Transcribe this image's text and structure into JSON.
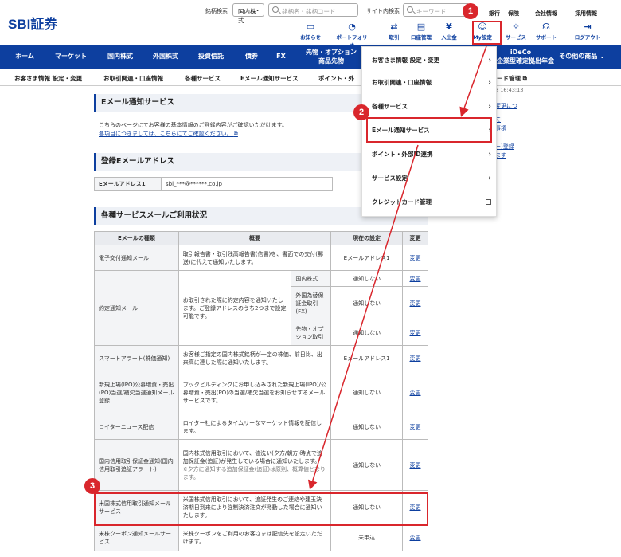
{
  "header": {
    "logo": "SBI証券",
    "brand_search_label": "銘柄検索",
    "domestic_select": "国内株式",
    "brand_placeholder": "銘柄名・銘柄コード",
    "site_search_label": "サイト内検索",
    "keyword_placeholder": "キーワード",
    "links": [
      "銀行",
      "保険",
      "会社情報",
      "採用情報"
    ]
  },
  "icons": [
    {
      "label": "お知らせ"
    },
    {
      "label": "ポートフォリオ"
    },
    {
      "label": "取引"
    },
    {
      "label": "口座管理"
    },
    {
      "label": "入出金"
    },
    {
      "label": "My設定"
    },
    {
      "label": "サービス"
    },
    {
      "label": "サポート"
    },
    {
      "label": "ログアウト"
    }
  ],
  "nav": [
    "ホーム",
    "マーケット",
    "国内株式",
    "外国株式",
    "投資信託",
    "債券",
    "FX",
    "先物・オプション 商品先物",
    "",
    "iDeCo 企業型確定拠出年金",
    "その他の商品"
  ],
  "nav_ideco_line1": "iDeCo",
  "nav_ideco_line2": "企業型確定拠出年金",
  "nav_futures_line1": "先物・オプション",
  "nav_futures_line2": "商品先物",
  "subnav": [
    "お客さま情報 設定・変更",
    "お取引関連・口座情報",
    "各種サービス",
    "Eメール通知サービス",
    "ポイント・外",
    "ード管理"
  ],
  "right": {
    "date": "8 16:43:13",
    "l1": "変更につ",
    "l2": "て",
    "l3": "事項",
    "l4": "ー)登録",
    "l5": "ます"
  },
  "section1": {
    "title": "Eメール通知サービス",
    "desc": "こちらのページにてお客様の基本情報のご登録内容がご確認いただけます。",
    "link": "各項目につきましては、こちらにてご確認ください。"
  },
  "section2": {
    "title": "登録Eメールアドレス",
    "key": "Eメールアドレス1",
    "value": "sbi_***@******.co.jp"
  },
  "section3": {
    "title": "各種サービスメールご利用状況",
    "headers": [
      "Eメールの種類",
      "概要",
      "現在の設定",
      "変更"
    ],
    "rows": [
      {
        "type": "電子交付通知メール",
        "desc": "取引報告書・取引残高報告書(信書)を、書面での交付(郵送)に代えて通知いたします。",
        "setting": "Eメールアドレス1",
        "change": "変更"
      },
      {
        "type": "約定通知メール",
        "desc": "お取引された際に約定内容を通知いたします。ご登録アドレスのうち2つまで設定可能です。",
        "sub": [
          {
            "name": "国内株式",
            "setting": "通知しない"
          },
          {
            "name": "外国為替保証金取引(FX)",
            "setting": "通知しない"
          },
          {
            "name": "先物・オプション取引",
            "setting": "通知しない"
          }
        ],
        "change": "変更"
      },
      {
        "type": "スマートアラート(株価通知)",
        "desc": "お客様ご指定の国内株式銘柄が一定の株価、前日比、出来高に達した際に通知いたします。",
        "setting": "Eメールアドレス1",
        "change": "変更"
      },
      {
        "type": "新規上場(IPO)公募増資・売出(PO)当選/補欠当選通知メール登録",
        "desc": "ブックビルディングにお申し込みされた新規上場(IPO)/公募増資・売出(PO)の当選/補欠当選をお知らせするメールサービスです。",
        "setting": "通知しない",
        "change": "変更"
      },
      {
        "type": "ロイターニュース配信",
        "desc": "ロイター社によるタイムリーなマーケット情報を配信します。",
        "setting": "通知しない",
        "change": "変更"
      },
      {
        "type": "国内信用取引保証金通知(国内信用取引追証アラート)",
        "desc": "国内株式信用取引において、値洗い(夕方/朝方)時点で追加保証金(追証)が発生している場合に通知いたします。",
        "note": "※夕方に通知する追加保証金(追証)は原則、概算値となります。",
        "setting": "通知しない",
        "change": "変更"
      },
      {
        "type": "米国株式信用取引通知メールサービス",
        "desc": "米国株式信用取引において、追証発生のご連絡や建玉決済期日到来により強制決済注文が発動した場合に通知いたします。",
        "setting": "通知しない",
        "change": "変更"
      },
      {
        "type": "米株クーポン通知メールサービス",
        "desc": "米株クーポンをご利用のお客さまは配信先を設定いただけます。",
        "setting": "未申込",
        "change": "変更"
      }
    ]
  },
  "dropdown": [
    {
      "label": "お客さま情報 設定・変更"
    },
    {
      "label": "お取引関連・口座情報"
    },
    {
      "label": "各種サービス"
    },
    {
      "label": "Eメール通知サービス"
    },
    {
      "label": "ポイント・外部ID連携"
    },
    {
      "label": "サービス設定"
    },
    {
      "label": "クレジットカード管理"
    }
  ],
  "badges": [
    "1",
    "2",
    "3"
  ],
  "colors": {
    "brand": "#0d3f9f",
    "highlight": "#d9262c"
  }
}
